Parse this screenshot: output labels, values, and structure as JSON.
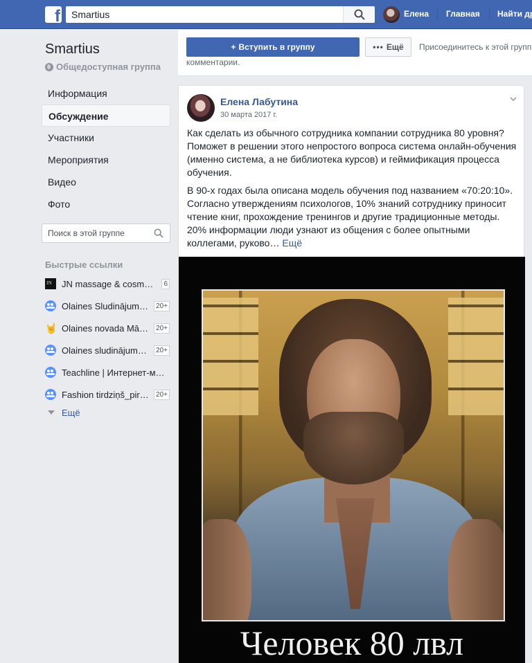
{
  "topbar": {
    "search_value": "Smartius",
    "user_name": "Елена",
    "home_link": "Главная",
    "find_friends_link": "Найти др"
  },
  "group": {
    "name": "Smartius",
    "type": "Общедоступная группа"
  },
  "nav": {
    "items": [
      {
        "label": "Информация",
        "active": false
      },
      {
        "label": "Обсуждение",
        "active": true
      },
      {
        "label": "Участники",
        "active": false
      },
      {
        "label": "Мероприятия",
        "active": false
      },
      {
        "label": "Видео",
        "active": false
      },
      {
        "label": "Фото",
        "active": false
      }
    ],
    "search_placeholder": "Поиск в этой группе"
  },
  "quick_links": {
    "header": "Быстрые ссылки",
    "items": [
      {
        "name": "JN massage & cosm…",
        "badge": "6",
        "icon": "page-logo-icon"
      },
      {
        "name": "Olaines Sludinājum…",
        "badge": "20+",
        "icon": "group-icon"
      },
      {
        "name": "Olaines novada Mā…",
        "badge": "20+",
        "icon": "hand-icon"
      },
      {
        "name": "Olaines sludinājum…",
        "badge": "20+",
        "icon": "group-icon"
      },
      {
        "name": "Teachline | Интернет-м…",
        "badge": "",
        "icon": "group-icon"
      },
      {
        "name": "Fashion tirdziņš_pir…",
        "badge": "20+",
        "icon": "group-icon"
      }
    ],
    "more_label": "Ещё"
  },
  "join_box": {
    "join_label": "Вступить в группу",
    "more_label": "Ещё",
    "hint_line1": "Присоединитесь к этой групп",
    "hint_line2": "комментарии."
  },
  "post": {
    "author": "Елена Лабутина",
    "date": "30 марта 2017 г.",
    "paragraph1": "Как сделать из обычного сотрудника компании сотрудника 80 уровня? Поможет в решении этого непростого вопроса система онлайн-обучения (именно система, а не библиотека курсов) и геймификация процесса обучения.",
    "paragraph2": "В 90-х годах была описана модель обучения под названием «70:20:10». Согласно утверждениям психологов, 10% знаний сотруднику приносит чтение книг, прохождение тренингов и другие традиционные методы. 20% информации люди узнают из общения с более опытными коллегами, руково…",
    "see_more": "Ещё",
    "image_caption": "Человек 80 лвл"
  },
  "colors": {
    "brand_blue": "#4267b2",
    "link_blue": "#365899",
    "page_bg": "#e9ebee"
  }
}
